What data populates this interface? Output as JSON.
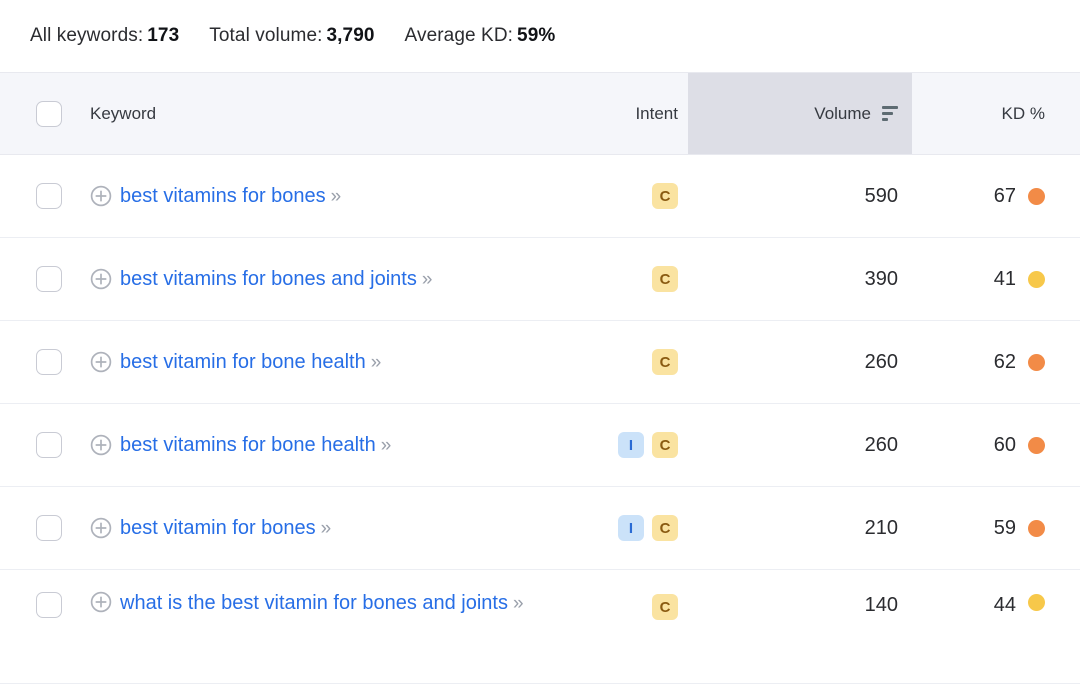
{
  "summary": {
    "items": [
      {
        "label": "All keywords:",
        "value": "173"
      },
      {
        "label": "Total volume:",
        "value": "3,790"
      },
      {
        "label": "Average KD:",
        "value": "59%"
      }
    ]
  },
  "table": {
    "columns": {
      "keyword": "Keyword",
      "intent": "Intent",
      "volume": "Volume",
      "kd": "KD %"
    },
    "sorted_column": "volume",
    "sort_direction": "descending",
    "sort_icon": "sort-descending-icon",
    "row_icons": {
      "add": "circle-plus-icon",
      "expand": "double-chevron-right-icon",
      "checkbox": "checkbox-icon"
    },
    "chevron_glyph": "»",
    "colors": {
      "link": "#276ee6",
      "header_bg": "#f5f6fa",
      "sorted_col_bg": "#dddee6",
      "kd_orange": "#f28b47",
      "kd_yellow": "#f7c84a",
      "intent_i_bg": "#cbe2f9",
      "intent_i_fg": "#2a6bd4",
      "intent_c_bg": "#fae3a1",
      "intent_c_fg": "#8a5b12"
    },
    "rows": [
      {
        "keyword": "best vitamins for bones",
        "intents": [
          "C"
        ],
        "volume": "590",
        "kd": "67",
        "kd_color": "#f28b47",
        "tall": false
      },
      {
        "keyword": "best vitamins for bones and joints",
        "intents": [
          "C"
        ],
        "volume": "390",
        "kd": "41",
        "kd_color": "#f7c84a",
        "tall": false
      },
      {
        "keyword": "best vitamin for bone health",
        "intents": [
          "C"
        ],
        "volume": "260",
        "kd": "62",
        "kd_color": "#f28b47",
        "tall": false
      },
      {
        "keyword": "best vitamins for bone health",
        "intents": [
          "I",
          "C"
        ],
        "volume": "260",
        "kd": "60",
        "kd_color": "#f28b47",
        "tall": false
      },
      {
        "keyword": "best vitamin for bones",
        "intents": [
          "I",
          "C"
        ],
        "volume": "210",
        "kd": "59",
        "kd_color": "#f28b47",
        "tall": false
      },
      {
        "keyword": "what is the best vitamin for bones and joints",
        "intents": [
          "C"
        ],
        "volume": "140",
        "kd": "44",
        "kd_color": "#f7c84a",
        "tall": true
      }
    ]
  }
}
